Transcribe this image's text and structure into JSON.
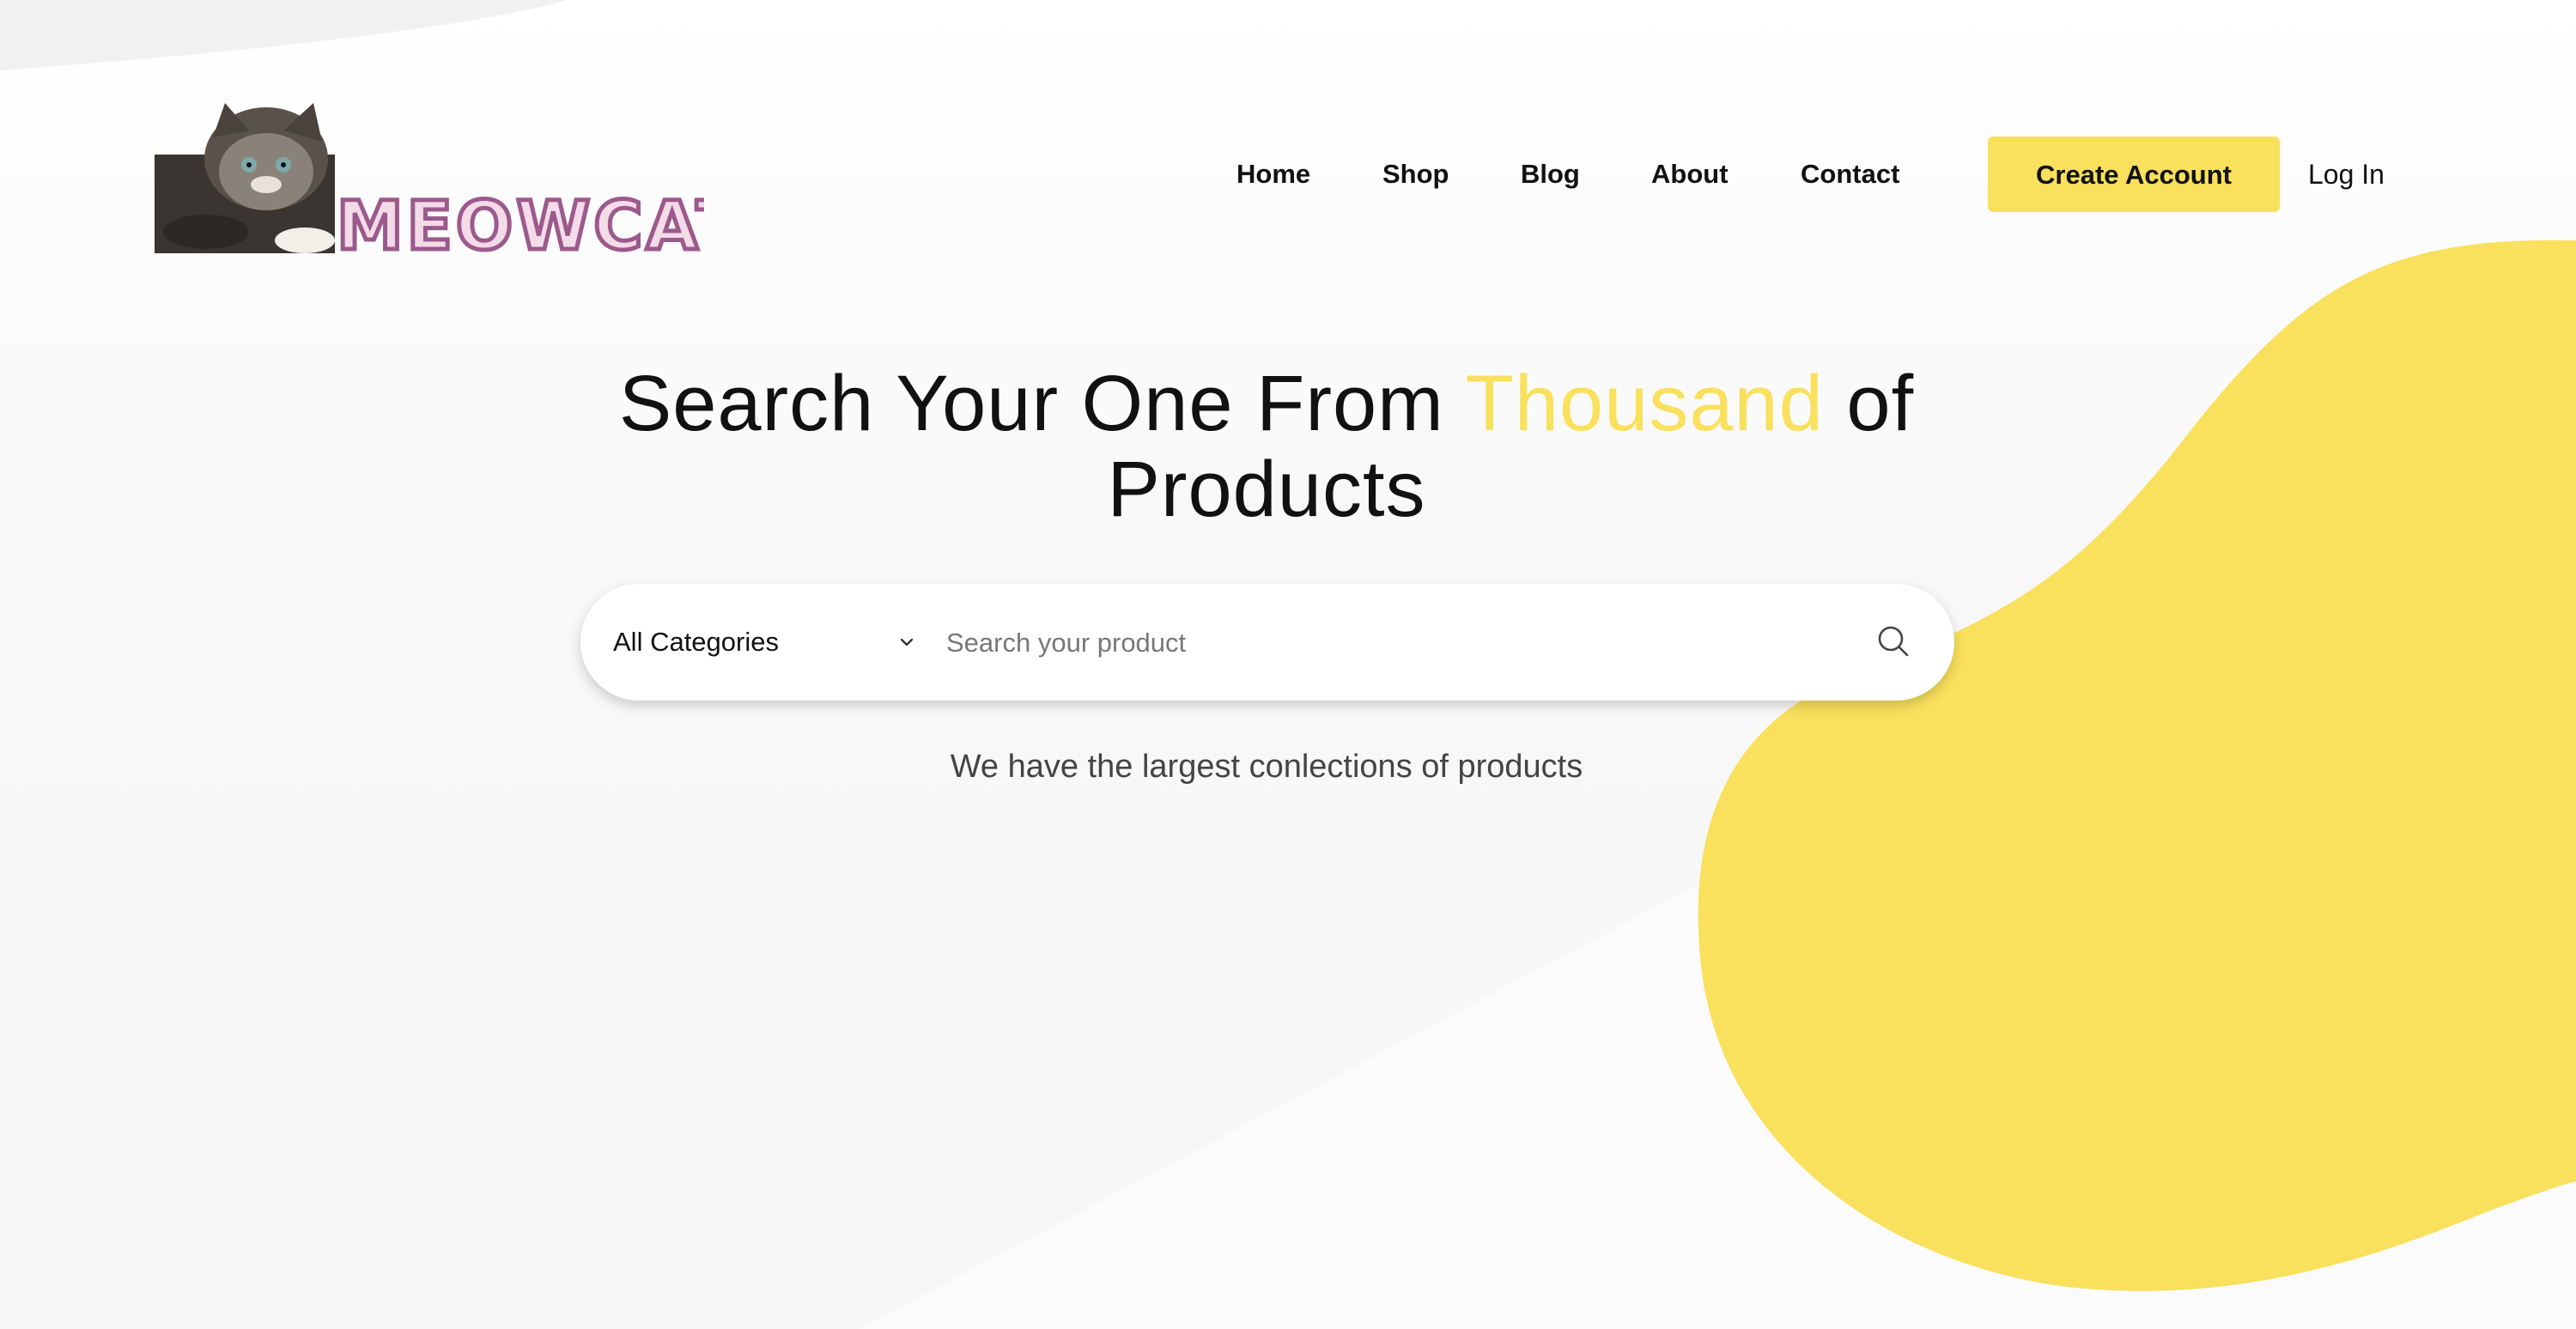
{
  "brand": {
    "logo_text": "MEOWCAT",
    "accent_color": "#f9e05d"
  },
  "nav": {
    "items": [
      {
        "label": "Home"
      },
      {
        "label": "Shop"
      },
      {
        "label": "Blog"
      },
      {
        "label": "About"
      },
      {
        "label": "Contact"
      }
    ],
    "create_account_label": "Create Account",
    "login_label": "Log In"
  },
  "hero": {
    "title_part1": "Search Your One From ",
    "title_accent": "Thousand",
    "title_part2": " of",
    "title_line2": "Products",
    "tagline": "We have the largest conlections of products"
  },
  "search": {
    "category_selected": "All Categories",
    "placeholder": "Search your product",
    "value": "",
    "icons": {
      "category": "chevron-down-icon",
      "submit": "search-icon"
    }
  }
}
